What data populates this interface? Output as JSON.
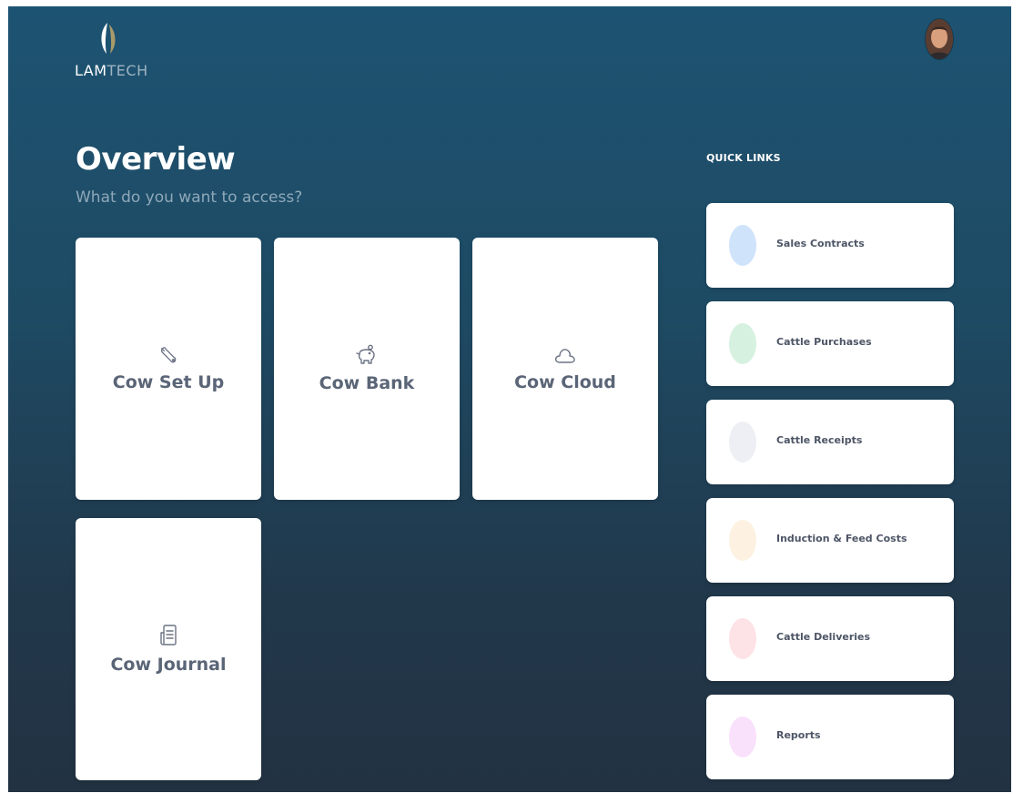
{
  "brand": {
    "name_primary": "LAM",
    "name_secondary": "TECH"
  },
  "header": {
    "avatar": "user-avatar"
  },
  "overview": {
    "title": "Overview",
    "subtitle": "What do you want to access?",
    "cards": [
      {
        "label": "Cow Set Up",
        "icon": "wrench-icon"
      },
      {
        "label": "Cow Bank",
        "icon": "piggy-bank-icon"
      },
      {
        "label": "Cow Cloud",
        "icon": "cloud-icon"
      },
      {
        "label": "Cow Journal",
        "icon": "journal-icon"
      }
    ]
  },
  "quick_links": {
    "heading": "QUICK LINKS",
    "items": [
      {
        "label": "Sales Contracts",
        "color": "#cfe3fb"
      },
      {
        "label": "Cattle Purchases",
        "color": "#d7f1e1"
      },
      {
        "label": "Cattle Receipts",
        "color": "#edeff4"
      },
      {
        "label": "Induction & Feed Costs",
        "color": "#fdf1e1"
      },
      {
        "label": "Cattle Deliveries",
        "color": "#fde2e6"
      },
      {
        "label": "Reports",
        "color": "#f9e0fb"
      }
    ]
  },
  "colors": {
    "background_top": "#1d5372",
    "background_bottom": "#223242",
    "card_text": "#5a6577",
    "subtitle": "#8fa8b9"
  }
}
